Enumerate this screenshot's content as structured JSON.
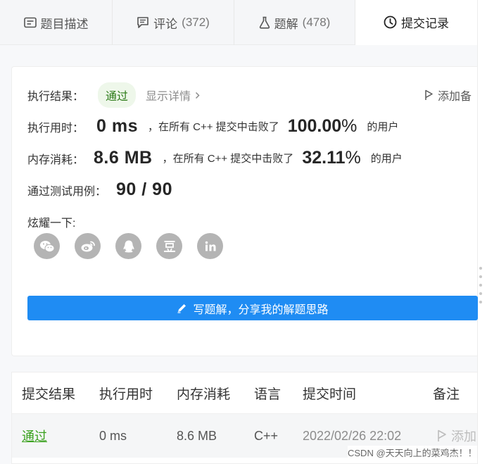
{
  "tabs": [
    {
      "label": "题目描述",
      "count": "",
      "icon": "description-icon"
    },
    {
      "label": "评论",
      "count": "(372)",
      "icon": "comment-icon"
    },
    {
      "label": "题解",
      "count": "(478)",
      "icon": "flask-icon"
    },
    {
      "label": "提交记录",
      "count": "",
      "icon": "clock-icon",
      "active": true
    }
  ],
  "result": {
    "status_label": "执行结果：",
    "status_value": "通过",
    "detail_link": "显示详情",
    "add_note": "添加备",
    "runtime_label": "执行用时：",
    "runtime_value": "0 ms",
    "runtime_text": "，在所有 C++ 提交中击败了",
    "runtime_pct": "100.00",
    "pct_symbol": "%",
    "users_text": "的用户",
    "memory_label": "内存消耗：",
    "memory_value": "8.6 MB",
    "memory_text": "，在所有 C++ 提交中击败了",
    "memory_pct": "32.11",
    "tests_label": "通过测试用例：",
    "tests_value": "90 / 90",
    "share_label": "炫耀一下:",
    "share_icons": [
      "wechat-icon",
      "weibo-icon",
      "qq-icon",
      "douban-icon",
      "linkedin-icon"
    ],
    "write_button": "写题解，分享我的解题思路"
  },
  "table": {
    "headers": [
      "提交结果",
      "执行用时",
      "内存消耗",
      "语言",
      "提交时间",
      "备注"
    ],
    "rows": [
      {
        "status": "通过",
        "runtime": "0 ms",
        "memory": "8.6 MB",
        "language": "C++",
        "time": "2022/02/26 22:02",
        "note": "添加"
      }
    ]
  },
  "watermark": "CSDN @天天向上的菜鸡杰！！",
  "colors": {
    "accent": "#1f8cf3",
    "success": "#3aa11e",
    "pill_bg": "#eef7ea"
  }
}
